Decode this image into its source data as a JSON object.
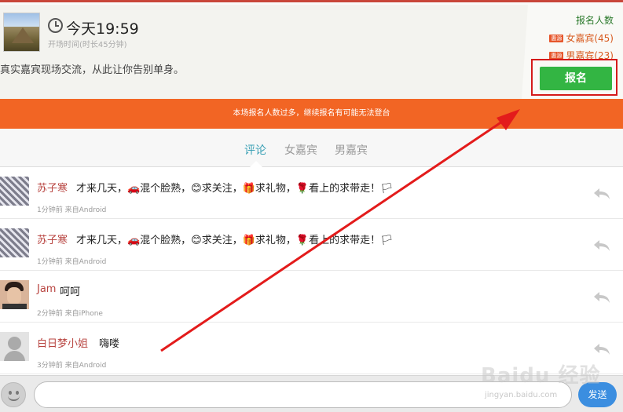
{
  "event": {
    "time": "今天19:59",
    "subtitle": "开场时间(时长45分钟)",
    "description": "真实嘉宾现场交流，从此让你告别单身。"
  },
  "signup_panel": {
    "title": "报名人数",
    "female": {
      "badge": "惠源",
      "label": "女嘉宾(45)"
    },
    "male": {
      "badge": "惠源",
      "label": "男嘉宾(23)"
    },
    "button_label": "报名"
  },
  "warning": "本场报名人数过多，继续报名有可能无法登台",
  "tabs": [
    {
      "label": "评论",
      "active": true
    },
    {
      "label": "女嘉宾",
      "active": false
    },
    {
      "label": "男嘉宾",
      "active": false
    }
  ],
  "comments": [
    {
      "name": "苏子寒",
      "text": "才来几天，🚗混个脸熟，😊求关注，🎁求礼物，🌹看上的求带走！🏳",
      "meta": "1分钟前 来自Android",
      "avatar": "zebra-avatar"
    },
    {
      "name": "苏子寒",
      "text": "才来几天，🚗混个脸熟，😊求关注，🎁求礼物，🌹看上的求带走！🏳",
      "meta": "1分钟前 来自Android",
      "avatar": "zebra-avatar"
    },
    {
      "name": "Jam",
      "text": "呵呵",
      "meta": "2分钟前 来自iPhone",
      "avatar": "man-avatar"
    },
    {
      "name": "白日梦小姐",
      "text": "嗨喽",
      "meta": "3分钟前 来自Android",
      "avatar": "default-avatar"
    }
  ],
  "composer": {
    "placeholder": "",
    "send_label": "发送"
  },
  "watermark": {
    "brand": "Baidu 经验",
    "url": "jingyan.baidu.com"
  },
  "colors": {
    "accent_orange": "#f26524",
    "signup_green": "#33b543",
    "highlight_red": "#d51a1a",
    "tab_active": "#3aa0b5",
    "name_color": "#b84440",
    "send_blue": "#3b8ee0"
  }
}
